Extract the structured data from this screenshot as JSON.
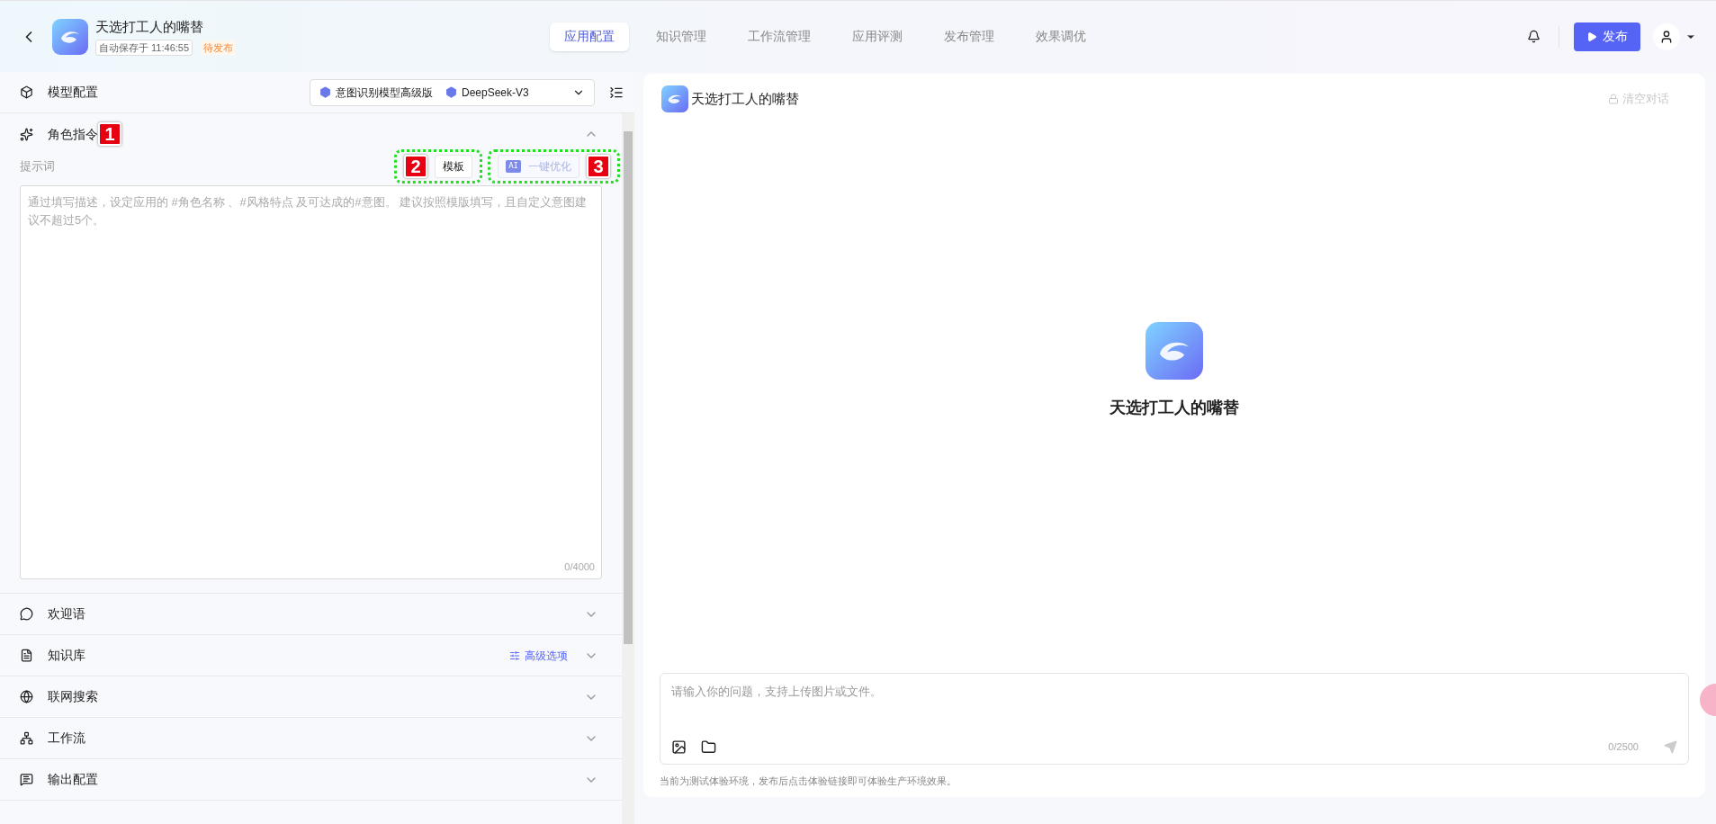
{
  "header": {
    "app_name": "天选打工人的嘴替",
    "autosave": "自动保存于 11:46:55",
    "status": "待发布"
  },
  "nav_tabs": [
    {
      "label": "应用配置",
      "selected": true
    },
    {
      "label": "知识管理",
      "selected": false
    },
    {
      "label": "工作流管理",
      "selected": false
    },
    {
      "label": "应用评测",
      "selected": false
    },
    {
      "label": "发布管理",
      "selected": false
    },
    {
      "label": "效果调优",
      "selected": false
    }
  ],
  "publish_button": "发布",
  "model_config": {
    "title": "模型配置",
    "models": [
      "意图识别模型高级版",
      "DeepSeek-V3"
    ]
  },
  "role_section": {
    "title": "角色指令",
    "expanded": true,
    "prompt_label": "提示词",
    "template_button": "模板",
    "optimize_button": {
      "badge": "AI",
      "label": "一键优化",
      "disabled": true
    },
    "placeholder": "通过填写描述，设定应用的 #角色名称 、#风格特点 及可达成的#意图。 建议按照模版填写，且自定义意图建议不超过5个。",
    "counter": "0/4000"
  },
  "sections": [
    {
      "kind": "welcome",
      "title": "欢迎语",
      "expanded": false
    },
    {
      "kind": "knowledge",
      "title": "知识库",
      "action": "高级选项",
      "expanded": false
    },
    {
      "kind": "web",
      "title": "联网搜索",
      "expanded": false
    },
    {
      "kind": "workflow",
      "title": "工作流",
      "expanded": false
    },
    {
      "kind": "output",
      "title": "输出配置",
      "expanded": false
    }
  ],
  "annotations": [
    {
      "label": "1"
    },
    {
      "label": "2"
    },
    {
      "label": "3"
    }
  ],
  "preview": {
    "title": "天选打工人的嘴替",
    "clear_button": "清空对话",
    "app_name": "天选打工人的嘴替",
    "input_placeholder": "请输入你的问题，支持上传图片或文件。",
    "counter": "0/2500",
    "footnote": "当前为测试体验环境，发布后点击体验链接即可体验生产环境效果。"
  }
}
